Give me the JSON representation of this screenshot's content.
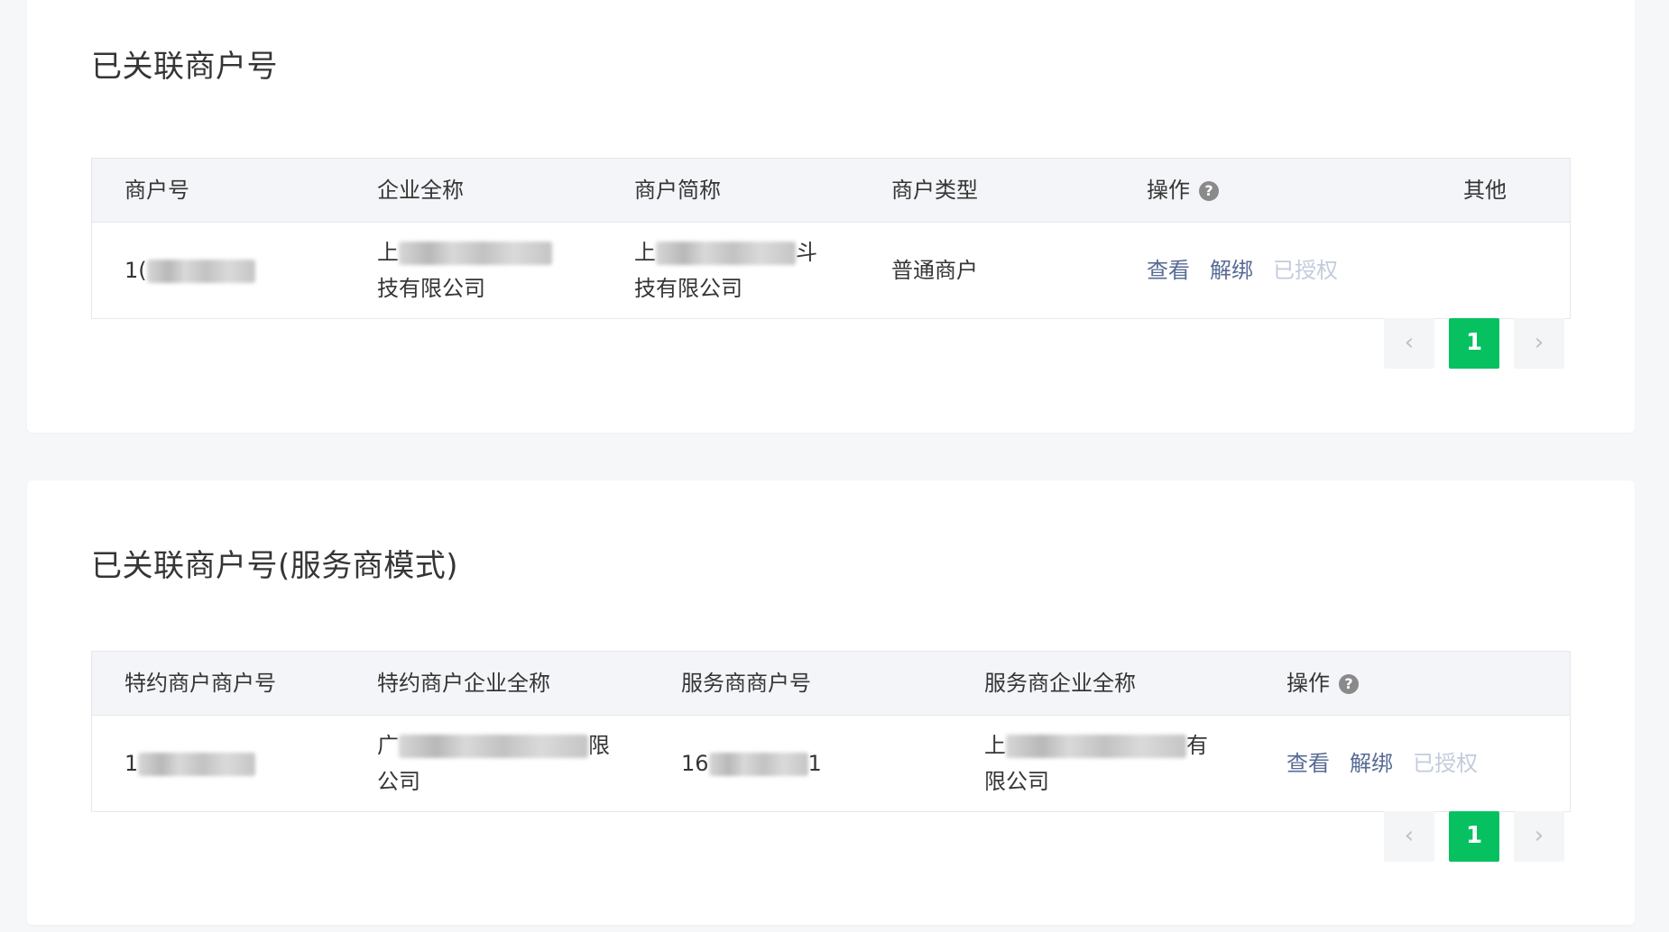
{
  "section1": {
    "title": "已关联商户号",
    "columns": [
      "商户号",
      "企业全称",
      "商户简称",
      "商户类型",
      "操作",
      "其他"
    ],
    "help_icon": "?",
    "row": {
      "merchant_id_prefix": "1(",
      "company_name_prefix": "上",
      "company_name_suffix": "技有限公司",
      "short_name_prefix": "上",
      "short_name_tail": "斗",
      "short_name_suffix": "技有限公司",
      "type": "普通商户",
      "actions": {
        "view": "查看",
        "unbind": "解绑",
        "authorized": "已授权"
      }
    },
    "pagination": {
      "prev": "‹",
      "current": "1",
      "next": "›"
    }
  },
  "section2": {
    "title": "已关联商户号(服务商模式)",
    "columns": [
      "特约商户商户号",
      "特约商户企业全称",
      "服务商商户号",
      "服务商企业全称",
      "操作"
    ],
    "help_icon": "?",
    "row": {
      "sub_merchant_id_prefix": "1",
      "sub_company_prefix": "广",
      "sub_company_tail": "限",
      "sub_company_suffix": "公司",
      "provider_id_prefix": "16",
      "provider_id_suffix": "1",
      "provider_company_prefix": "上",
      "provider_company_tail": "有",
      "provider_company_suffix": "限公司",
      "actions": {
        "view": "查看",
        "unbind": "解绑",
        "authorized": "已授权"
      }
    },
    "pagination": {
      "prev": "‹",
      "current": "1",
      "next": "›"
    }
  },
  "colors": {
    "background": "#f6f7f9",
    "link": "#576b95",
    "disabled_link": "#c3cbdc",
    "pager_active": "#07c160"
  }
}
